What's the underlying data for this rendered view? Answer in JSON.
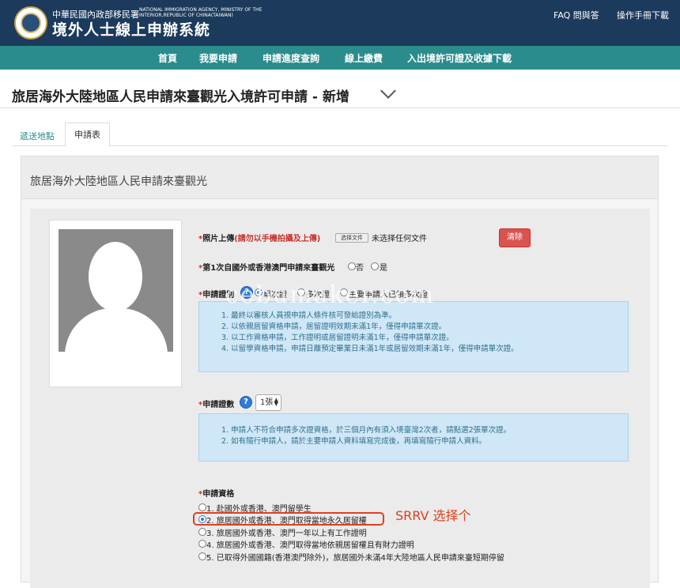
{
  "header": {
    "org_zh": "中華民國內政部移民署",
    "org_en": "NATIONAL IMMIGRATION AGENCY, MINISTRY OF THE INTERIOR,REPUBLIC OF CHINA(TAIWAN)",
    "system_title": "境外人士線上申辦系統",
    "links": [
      "FAQ 問與答",
      "操作手冊下載"
    ]
  },
  "nav": {
    "items": [
      "首頁",
      "我要申請",
      "申請進度查詢",
      "線上繳費",
      "入出境許可證及收據下載"
    ]
  },
  "page_title": "旅居海外大陸地區人民申請來臺觀光入境許可申請 - 新增",
  "tabs": [
    "遞送地點",
    "申請表"
  ],
  "panel_title": "旅居海外大陸地區人民申請來臺觀光",
  "photo": {
    "label": "照片上傳",
    "note": "(請勿以手機拍攝及上傳)",
    "file_button": "选择文件",
    "file_status": "未选择任何文件",
    "clear_button": "清除"
  },
  "first_time": {
    "label": "第1次自國外或香港澳門申請來臺觀光",
    "options": [
      "否",
      "是"
    ]
  },
  "permit": {
    "label": "申請證別",
    "options": [
      "單次證",
      "多次證",
      "主要申請人已領多次證"
    ],
    "info": [
      "1. 最終以審核人員視申請人條件核可發給證別為準。",
      "2. 以依親居留資格申請，居留證明效期未滿1年，僅得申請單次證。",
      "3. 以工作資格申請，工作證明或居留證明未滿1年，僅得申請單次證。",
      "4. 以留學資格申請，申請日離預定畢業日未滿1年或居留效期未滿1年，僅得申請單次證。"
    ]
  },
  "count": {
    "label": "申請證數",
    "selected": "1張",
    "info": [
      "1. 申請人不符合申請多次證資格，於三個月內有須入境臺灣2次者，請點選2張單次證。",
      "2. 如有隨行申請人，請於主要申請人資料填寫完成後，再填寫隨行申請人資料。"
    ]
  },
  "qualification": {
    "label": "申請資格",
    "options": [
      "1. 赴國外或香港、澳門留學生",
      "2. 旅居國外或香港、澳門取得當地永久居留權",
      "3. 旅居國外或香港、澳門一年以上有工作證明",
      "4. 旅居國外或香港、澳門取得當地依親居留權且有財力證明",
      "5. 已取得外國國籍(香港澳門除外)，旅居國外未滿4年大陸地區人民申請來臺短期停留"
    ],
    "selected_index": 1
  },
  "required_mark": "*",
  "help_glyph": "?",
  "annotation": "SRRV 选择个",
  "watermark": "cebumaker.com",
  "colors": {
    "header": "#1b3a5c",
    "nav": "#2a8c8c",
    "danger": "#d9534f",
    "annotation": "#e0401c",
    "info_bg": "#cfe7f6"
  }
}
